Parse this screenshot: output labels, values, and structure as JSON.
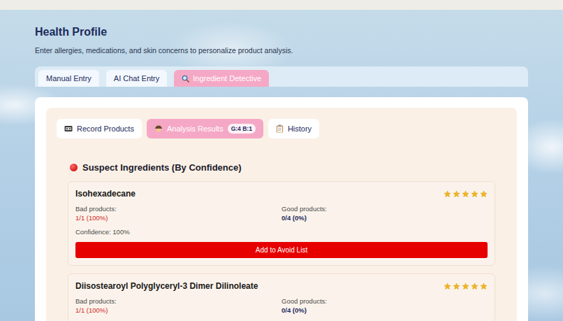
{
  "page": {
    "title": "Health Profile",
    "subtitle": "Enter allergies, medications, and skin concerns to personalize product analysis."
  },
  "tabs": [
    {
      "label": "Manual Entry",
      "selected": false
    },
    {
      "label": "AI Chat Entry",
      "selected": false
    },
    {
      "label": "Ingredient Detective",
      "selected": true
    }
  ],
  "subtabs": [
    {
      "label": "Record Products",
      "selected": false
    },
    {
      "label": "Analysis Results",
      "selected": true,
      "badge": "G:4 B:1"
    },
    {
      "label": "History",
      "selected": false
    }
  ],
  "section": {
    "title": "Suspect Ingredients (By Confidence)"
  },
  "ingredients": [
    {
      "name": "Isohexadecane",
      "stars": 5,
      "bad_label": "Bad products:",
      "bad_value": "1/1 (100%)",
      "good_label": "Good products:",
      "good_value": "0/4 (0%)",
      "confidence": "Confidence: 100%",
      "button": "Add to Avoid List"
    },
    {
      "name": "Diisostearoyl Polyglyceryl-3 Dimer Dilinoleate",
      "stars": 5,
      "bad_label": "Bad products:",
      "bad_value": "1/1 (100%)",
      "good_label": "Good products:",
      "good_value": "0/4 (0%)"
    }
  ]
}
